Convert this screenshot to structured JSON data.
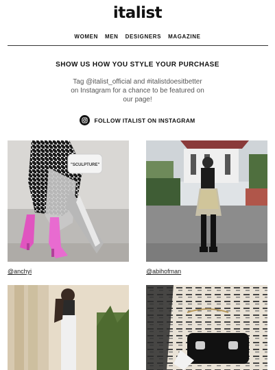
{
  "header": {
    "logo": "italist",
    "nav": [
      "WOMEN",
      "MEN",
      "DESIGNERS",
      "MAGAZINE"
    ]
  },
  "promo": {
    "headline": "SHOW US HOW YOU STYLE YOUR PURCHASE",
    "body": "Tag @italist_official and #italistdoesitbetter on Instagram for a chance to be featured on our page!",
    "follow_label": "FOLLOW ITALIST ON INSTAGRAM"
  },
  "gallery": {
    "posts": [
      {
        "handle": "@anchyi",
        "bag_text": "\"SCULPTURE\""
      },
      {
        "handle": "@abihofman"
      },
      {
        "handle": ""
      },
      {
        "handle": ""
      }
    ]
  },
  "icons": {
    "instagram": "instagram-icon"
  },
  "colors": {
    "accent": "#111111",
    "rule": "#333333",
    "subtext": "#555555"
  }
}
